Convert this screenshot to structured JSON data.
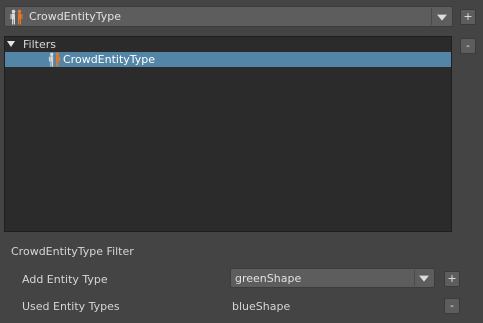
{
  "entity_selector": {
    "value": "CrowdEntityType",
    "icon": "crowd-entity-icon"
  },
  "buttons": {
    "add_top": "+",
    "remove_top": "-",
    "add_entity": "+",
    "remove_entity": "-"
  },
  "tree": {
    "root_label": "Filters",
    "child_label": "CrowdEntityType",
    "child_icon": "crowd-entity-icon"
  },
  "filter_section": {
    "heading": "CrowdEntityType Filter",
    "add_entity_type_label": "Add Entity Type",
    "add_entity_type_value": "greenShape",
    "used_entity_types_label": "Used Entity Types",
    "used_entity_types_value": "blueShape"
  },
  "colors": {
    "background": "#444444",
    "tree_background": "#2b2b2b",
    "selection": "#5285a6",
    "icon_orange": "#e07a2a"
  }
}
